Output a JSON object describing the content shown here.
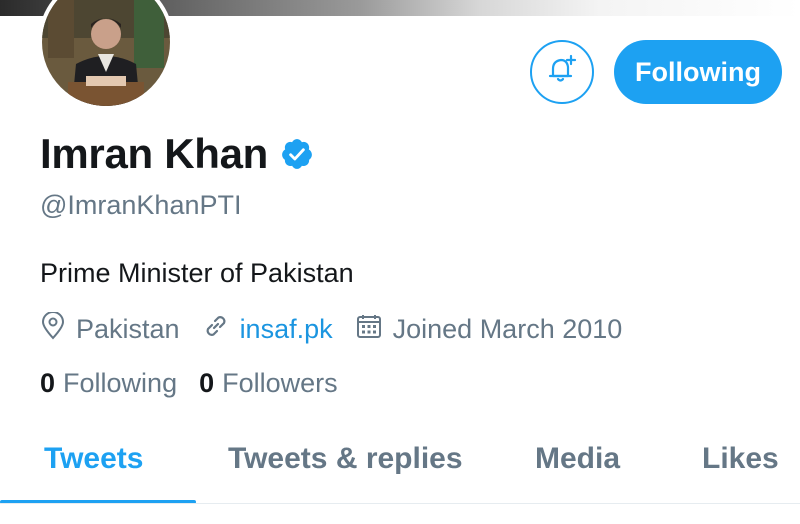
{
  "profile": {
    "display_name": "Imran Khan",
    "handle": "@ImranKhanPTI",
    "bio": "Prime Minister of Pakistan",
    "location": "Pakistan",
    "website": "insaf.pk",
    "joined": "Joined March 2010",
    "verified": true
  },
  "actions": {
    "follow_label": "Following",
    "bell_icon": "bell-plus-icon"
  },
  "stats": {
    "following_count": "0",
    "following_label": "Following",
    "followers_count": "0",
    "followers_label": "Followers"
  },
  "tabs": [
    {
      "label": "Tweets",
      "active": true
    },
    {
      "label": "Tweets & replies",
      "active": false
    },
    {
      "label": "Media",
      "active": false
    },
    {
      "label": "Likes",
      "active": false
    }
  ],
  "colors": {
    "accent": "#1da1f2",
    "link": "#1b95e0",
    "secondary_text": "#657786",
    "primary_text": "#14171a"
  }
}
